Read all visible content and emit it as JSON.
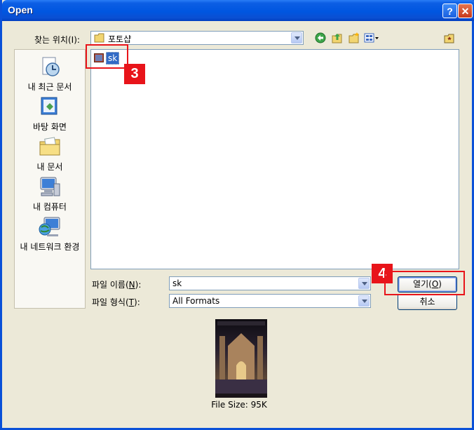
{
  "window": {
    "title": "Open",
    "help_label": "?",
    "close_label": "✕"
  },
  "lookin": {
    "label": "찾는 위치(I):",
    "value": "포토샵"
  },
  "toolbar": {
    "icons": [
      "back-icon",
      "up-folder-icon",
      "new-folder-icon",
      "view-menu-icon",
      "favorite-folder-icon"
    ]
  },
  "places": [
    {
      "label": "내 최근 문서",
      "icon": "recent-documents-icon"
    },
    {
      "label": "바탕 화면",
      "icon": "desktop-icon"
    },
    {
      "label": "내 문서",
      "icon": "my-documents-icon"
    },
    {
      "label": "내 컴퓨터",
      "icon": "my-computer-icon"
    },
    {
      "label": "내 네트워크 환경",
      "icon": "network-icon"
    }
  ],
  "files": [
    {
      "name": "sk",
      "selected": true
    }
  ],
  "filename": {
    "label_pre": "파일 이름(",
    "label_key": "N",
    "label_post": "):",
    "value": "sk"
  },
  "filetype": {
    "label_pre": "파일 형식(",
    "label_key": "T",
    "label_post": "):",
    "value": "All Formats"
  },
  "buttons": {
    "open_pre": "열기(",
    "open_key": "O",
    "open_post": ")",
    "cancel": "취소"
  },
  "annotations": {
    "step3": "3",
    "step4": "4"
  },
  "preview": {
    "file_size": "File Size: 95K"
  },
  "colors": {
    "title_bar": "#0055e5",
    "selection": "#316ac5",
    "callout": "#e8141a",
    "dialog_bg": "#ece9d8"
  }
}
